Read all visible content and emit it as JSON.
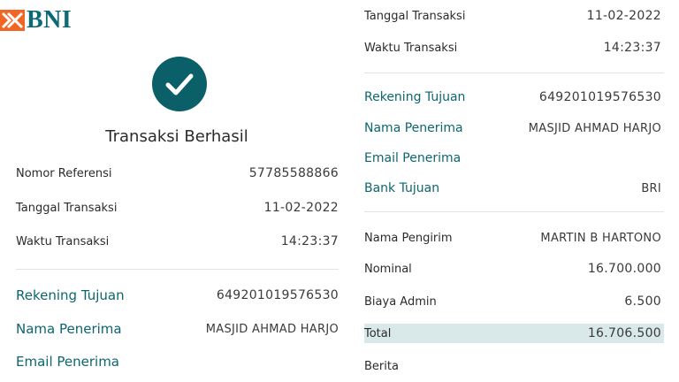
{
  "brand": {
    "name": "BNI",
    "accent": "#0b5f69",
    "logo_orange": "#f26522"
  },
  "left": {
    "status_title": "Transaksi Berhasil",
    "rows": [
      {
        "label": "Nomor Referensi",
        "value": "57785588866"
      },
      {
        "label": "Tanggal Transaksi",
        "value": "11-02-2022"
      },
      {
        "label": "Waktu Transaksi",
        "value": "14:23:37"
      }
    ],
    "dest": [
      {
        "label": "Rekening Tujuan",
        "value": "649201019576530"
      },
      {
        "label": "Nama Penerima",
        "value": "MASJID AHMAD HARJO"
      },
      {
        "label": "Email Penerima",
        "value": ""
      }
    ]
  },
  "right": {
    "rows": [
      {
        "label": "Tanggal Transaksi",
        "value": "11-02-2022"
      },
      {
        "label": "Waktu Transaksi",
        "value": "14:23:37"
      }
    ],
    "dest": [
      {
        "label": "Rekening Tujuan",
        "value": "649201019576530"
      },
      {
        "label": "Nama Penerima",
        "value": "MASJID AHMAD HARJO"
      },
      {
        "label": "Email Penerima",
        "value": ""
      },
      {
        "label": "Bank Tujuan",
        "value": "BRI"
      }
    ],
    "payment": [
      {
        "label": "Nama Pengirim",
        "value": "MARTIN B HARTONO"
      },
      {
        "label": "Nominal",
        "value": "16.700.000"
      },
      {
        "label": "Biaya Admin",
        "value": "6.500"
      },
      {
        "label": "Total",
        "value": "16.706.500"
      },
      {
        "label": "Berita",
        "value": ""
      }
    ]
  }
}
